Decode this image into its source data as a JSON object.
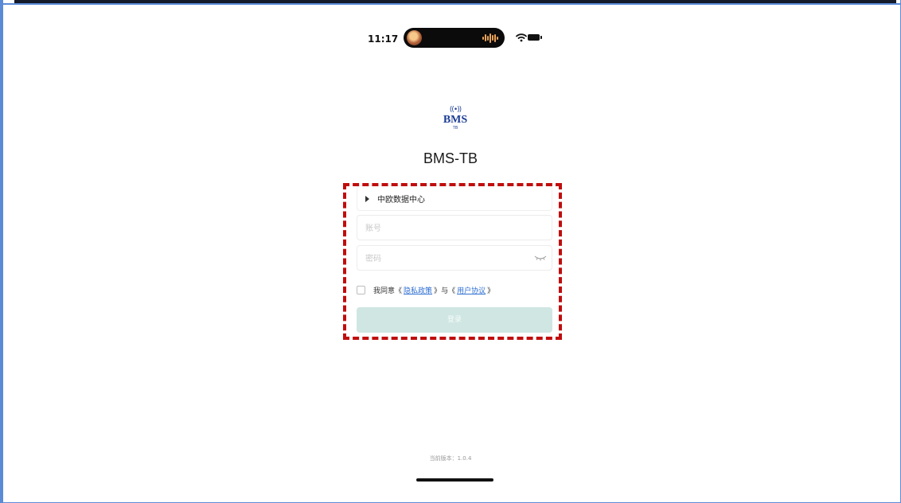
{
  "status_bar": {
    "time": "11:17",
    "icons": [
      "dynamic-island-avatar",
      "audio-waveform-icon",
      "wifi-icon",
      "battery-icon"
    ]
  },
  "logo": {
    "signal": "((•))",
    "text": "BMS",
    "sub": "TB"
  },
  "app_title": "BMS-TB",
  "form": {
    "server_label": "中欧数据中心",
    "account_placeholder": "账号",
    "password_placeholder": "密码",
    "agree": {
      "prefix": "我同意",
      "open_bracket": "《",
      "close_bracket": "》",
      "privacy_link": "隐私政策",
      "connector": "与",
      "terms_link": "用户协议"
    },
    "login_label": "登录"
  },
  "version": "当前版本：1.0.4",
  "colors": {
    "annotation_dash": "#c00d0d",
    "login_button_disabled": "#cfe6e2",
    "link": "#2f6fd1",
    "logo_blue": "#1b3c95",
    "frame_border": "#5b8bd6"
  }
}
